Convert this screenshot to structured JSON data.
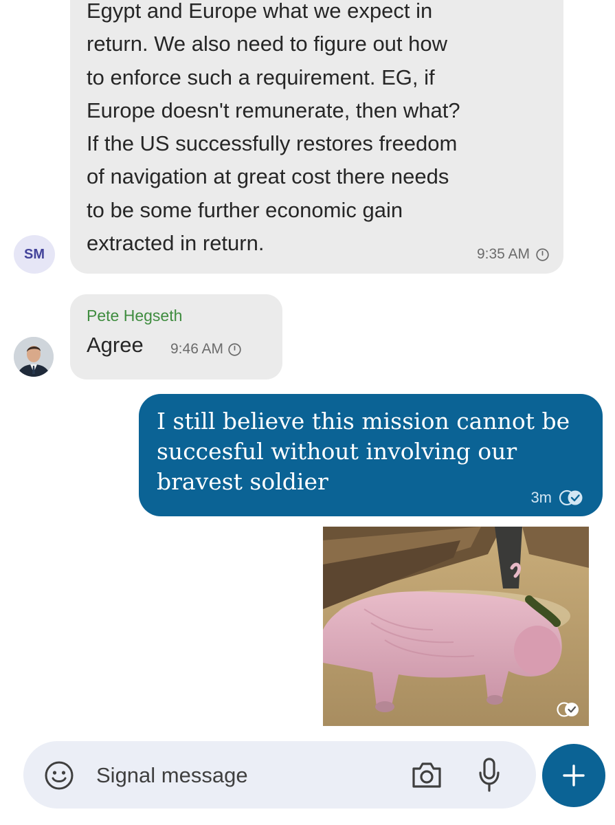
{
  "conversation": {
    "messages": [
      {
        "text": "Egypt and Europe what we expect in\nreturn. We also need to figure out how\nto enforce such a requirement. EG, if\nEurope doesn't remunerate, then what?\nIf the US successfully restores freedom\nof navigation at great cost there needs\nto be some further economic gain\nextracted in return.",
        "time": "9:35 AM",
        "avatar_initials": "SM"
      },
      {
        "sender": "Pete Hegseth",
        "text": "Agree",
        "time": "9:46 AM"
      },
      {
        "text": "I still believe this mission cannot be succesful without involving our bravest soldier",
        "time": "3m",
        "status_icon": "read-check-icon"
      }
    ]
  },
  "composer": {
    "placeholder": "Signal message"
  },
  "colors": {
    "outgoing_bubble": "#0b6395",
    "incoming_bubble": "#ebebeb",
    "sender_name": "#3f8c3f",
    "composer_bg": "#ebeef6"
  },
  "icons": [
    "clock-icon",
    "read-check-icon",
    "emoji-icon",
    "camera-icon",
    "microphone-icon",
    "plus-icon"
  ]
}
